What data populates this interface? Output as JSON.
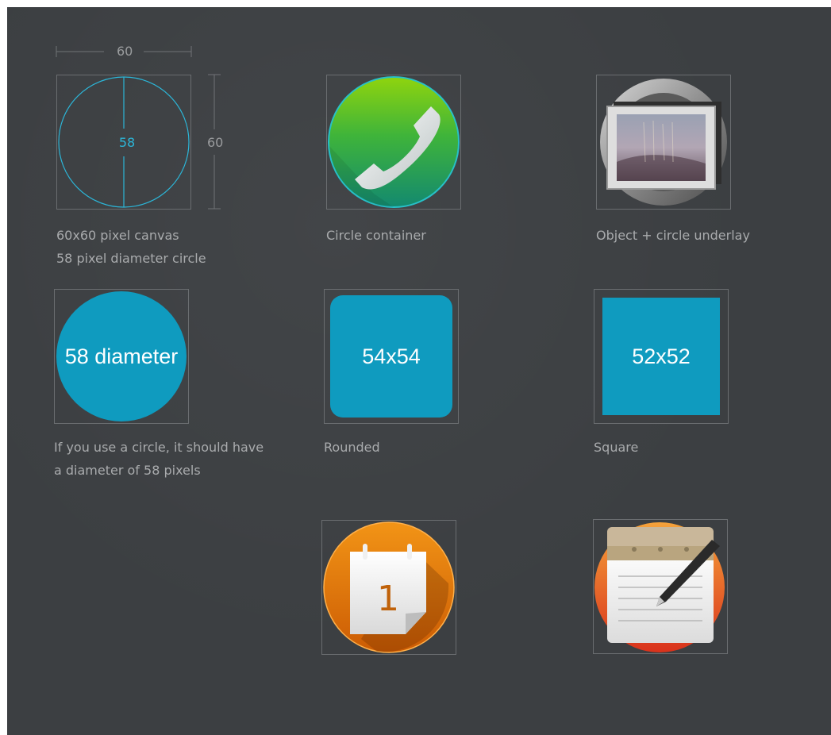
{
  "diagram": {
    "width_label": "60",
    "height_label": "60",
    "diameter_label": "58",
    "caption_line1": "60x60 pixel canvas",
    "caption_line2": "58 pixel diameter circle"
  },
  "examples": {
    "circle_container_caption": "Circle container",
    "object_underlay_caption": "Object + circle underlay"
  },
  "shapes": {
    "circle_label": "58 diameter",
    "circle_caption_line1": "If you use a circle, it should have",
    "circle_caption_line2": "a diameter of 58 pixels",
    "rounded_label": "54x54",
    "rounded_caption": "Rounded",
    "square_label": "52x52",
    "square_caption": "Square"
  },
  "calendar_icon": {
    "day": "1"
  },
  "colors": {
    "background": "#3c3f42",
    "accent_blue": "#0f9bbf",
    "guide_cyan": "#2cb6d8",
    "caption_gray": "#a9abad"
  }
}
